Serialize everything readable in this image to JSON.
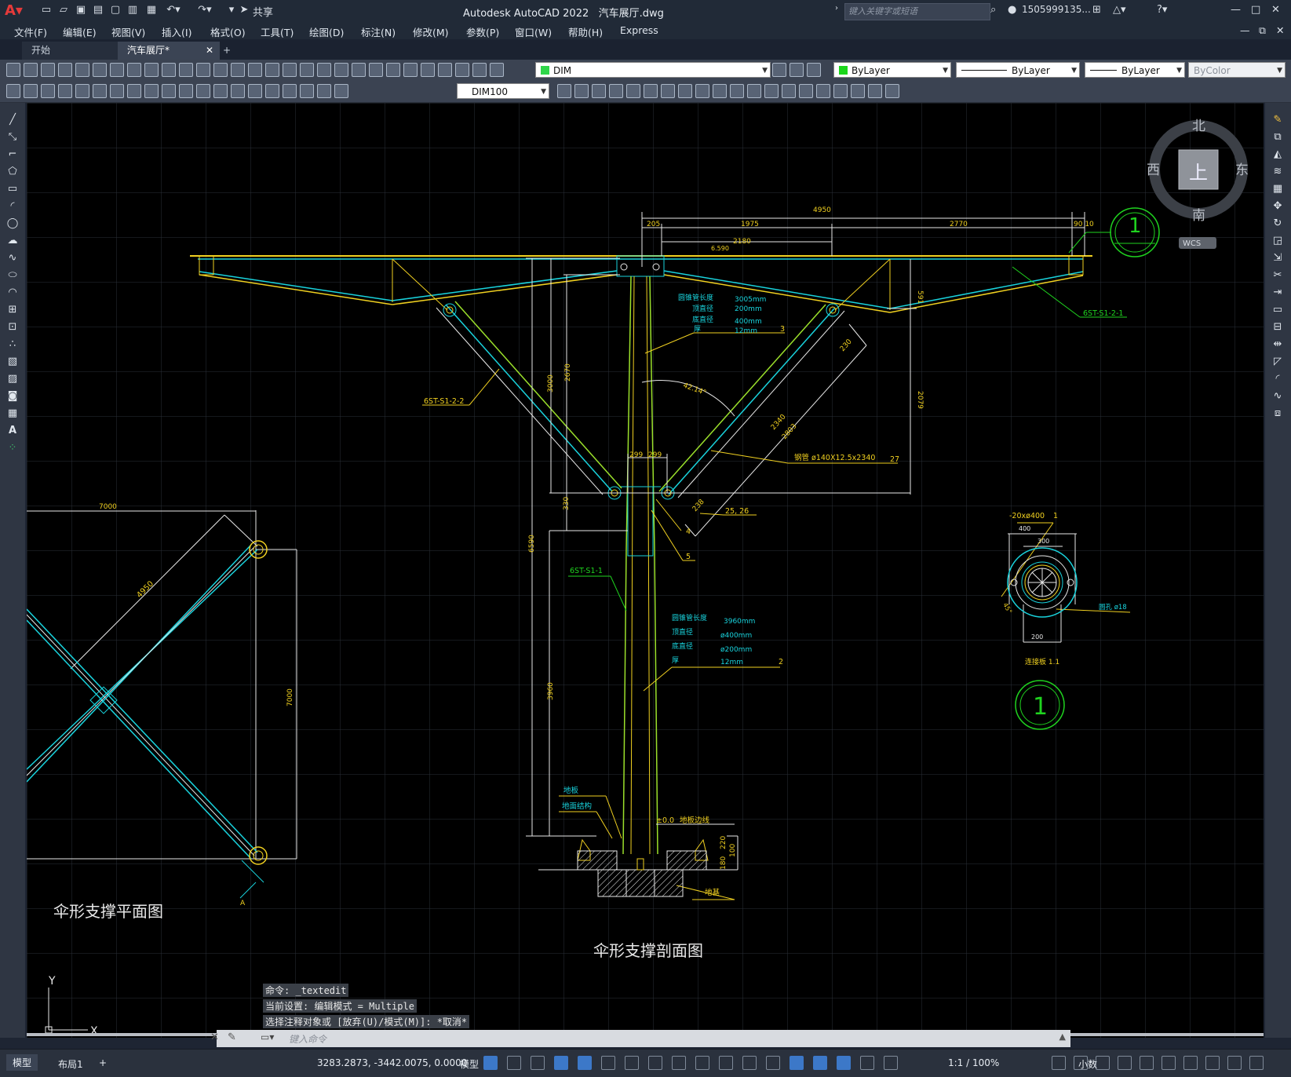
{
  "app": {
    "title": "Autodesk AutoCAD 2022",
    "file": "汽车展厅.dwg",
    "share": "共享"
  },
  "search": {
    "placeholder": "键入关键字或短语"
  },
  "user": {
    "name": "1505999135..."
  },
  "menu": [
    "文件(F)",
    "编辑(E)",
    "视图(V)",
    "插入(I)",
    "格式(O)",
    "工具(T)",
    "绘图(D)",
    "标注(N)",
    "修改(M)",
    "参数(P)",
    "窗口(W)",
    "帮助(H)",
    "Express"
  ],
  "tabs": [
    {
      "label": "开始"
    },
    {
      "label": "汽车展厅*"
    }
  ],
  "properties": {
    "layer": "DIM",
    "color": "ByLayer",
    "linetype": "ByLayer",
    "lineweight": "ByLayer",
    "plotstyle": "ByColor",
    "dimstyle": "DIM100"
  },
  "viewcube": {
    "north": "北",
    "south": "南",
    "east": "东",
    "west": "西",
    "top": "上",
    "wcs": "WCS"
  },
  "drawing": {
    "plan_title": "伞形支撑平面图",
    "section_title": "伞形支撑剖面图",
    "dims": {
      "total": "4950",
      "d205": "205",
      "d1975": "1975",
      "d2770": "2770",
      "d9010": "90 10",
      "d2180": "2180",
      "elev": "6.590",
      "d591": "591",
      "d2079": "2079",
      "d3000": "3000",
      "d2670": "2670",
      "d6590": "6590",
      "d330": "330",
      "d3960": "3960",
      "d299a": "299",
      "d299b": "299",
      "angle": "42.14°",
      "d2340": "2340",
      "d2803": "2803",
      "d230": "230",
      "d238": "238",
      "d7000a": "7000",
      "d7000b": "7000",
      "d4950": "4950",
      "d180": "180",
      "d220": "220",
      "d100": "100"
    },
    "labels": {
      "s122": "6ST-S1-2-2",
      "s121": "6ST-S1-2-1",
      "s11": "6ST-S1-1",
      "pipe": "钢管 ø140X12.5x2340",
      "n27": "27",
      "n2526": "25, 26",
      "n4": "4",
      "n5": "5",
      "n3": "3",
      "n2": "2",
      "n1": "1",
      "plate": "-20xø400",
      "floor": "地板",
      "floorstruct": "地面结构",
      "zero": "±0.0",
      "floorline": "地板边线",
      "base": "地基",
      "bolthole": "圆孔 ø18",
      "conn": "连接板 1.1",
      "circ1": "1",
      "circ2": "1",
      "markA": "A",
      "d400": "400",
      "d300": "300",
      "d200": "200",
      "d45": "45°"
    },
    "spec1": {
      "a": "圆锥管长度",
      "av": "3005mm",
      "b": "顶直径",
      "bv": "200mm",
      "c": "底直径",
      "cv": "400mm",
      "d": "厚",
      "dv": "12mm"
    },
    "spec2": {
      "a": "圆锥管长度",
      "av": "3960mm",
      "b": "顶直径",
      "bv": "ø400mm",
      "c": "底直径",
      "cv": "ø200mm",
      "d": "厚",
      "dv": "12mm"
    }
  },
  "command": {
    "history": [
      "命令: _textedit",
      "当前设置: 编辑模式 = Multiple",
      "选择注释对象或 [放弃(U)/模式(M)]: *取消*"
    ],
    "placeholder": "键入命令"
  },
  "layouts": [
    {
      "label": "模型"
    },
    {
      "label": "布局1"
    }
  ],
  "status": {
    "coords": "3283.2873, -3442.0075, 0.0000",
    "space": "模型",
    "scale": "1:1 / 100%",
    "units": "小数"
  },
  "ucs": {
    "x": "X",
    "y": "Y"
  }
}
